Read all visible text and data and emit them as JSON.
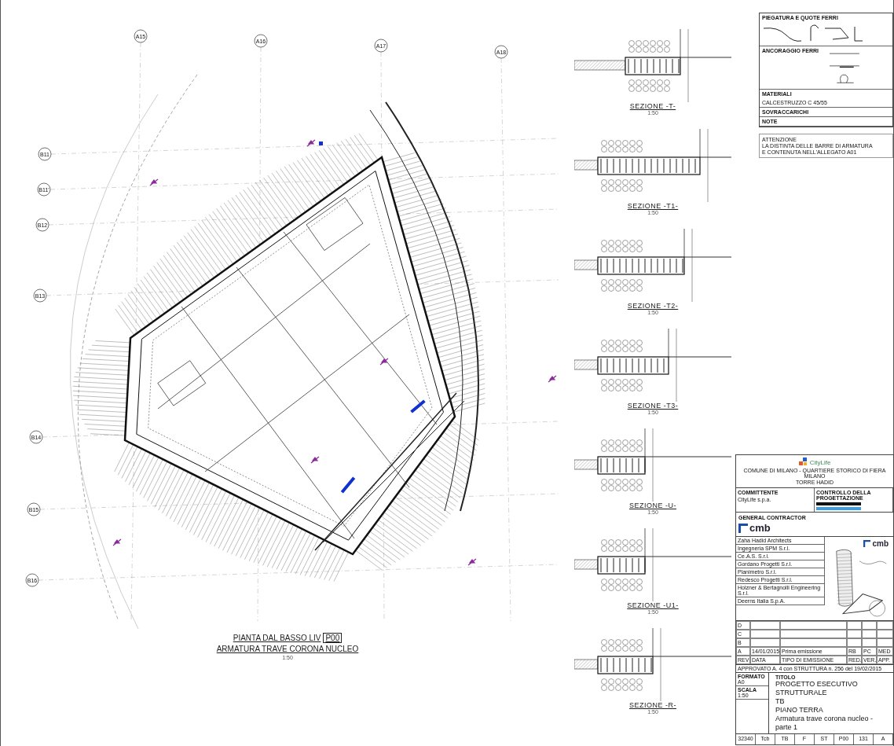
{
  "plan": {
    "axes": [
      {
        "label": "A15"
      },
      {
        "label": "A16"
      },
      {
        "label": "A17"
      },
      {
        "label": "A18"
      },
      {
        "label": "B11"
      },
      {
        "label": "B11'"
      },
      {
        "label": "B12"
      },
      {
        "label": "B13"
      },
      {
        "label": "B14"
      },
      {
        "label": "B15"
      },
      {
        "label": "B16"
      }
    ],
    "title": "PIANTA DAL BASSO LIV",
    "level": "P00",
    "subtitle": "ARMATURA TRAVE CORONA NUCLEO",
    "scale": "1:50"
  },
  "sections": [
    {
      "title": "SEZIONE -T-",
      "scale": "1:50"
    },
    {
      "title": "SEZIONE -T1-",
      "scale": "1:50"
    },
    {
      "title": "SEZIONE -T2-",
      "scale": "1:50"
    },
    {
      "title": "SEZIONE -T3-",
      "scale": "1:50"
    },
    {
      "title": "SEZIONE -U-",
      "scale": "1:50"
    },
    {
      "title": "SEZIONE -U1-",
      "scale": "1:50"
    },
    {
      "title": "SEZIONE -R-",
      "scale": "1:50"
    }
  ],
  "legend": {
    "bending_title": "PIEGATURA E QUOTE FERRI",
    "anchorage_title": "ANCORAGGIO FERRI",
    "materials_title": "MATERIALI",
    "materials_text": "CALCESTRUZZO C 45/55",
    "loads_title": "SOVRACCARICHI",
    "notes_title": "NOTE"
  },
  "warning": [
    "ATTENZIONE",
    "LA DISTINTA DELLE BARRE DI ARMATURA",
    "E CONTENUTA NELL'ALLEGATO A01"
  ],
  "title_block": {
    "logo_text": "CityLife",
    "project": "COMUNE DI MILANO - QUARTIERE STORICO DI FIERA MILANO",
    "building": "TORRE HADID",
    "client_label": "COMMITTENTE",
    "client": "CityLife s.p.a.",
    "control_label": "CONTROLLO DELLA PROGETTAZIONE",
    "contractor_label": "GENERAL CONTRACTOR",
    "contractor": "cmb",
    "companies": [
      "Zaha Hadid Architects",
      "Ingegneria SPM S.r.l.",
      "Ce.A.S. S.r.l.",
      "Gordano Progetti S.r.l.",
      "Planimetro S.r.l.",
      "Redesco Progetti S.r.l.",
      "Holzner & Bertagnolli Engineering S.r.l.",
      "Deerns Italia S.p.A."
    ],
    "sketch_logo": "cmb",
    "revisions": [
      {
        "rev": "D"
      },
      {
        "rev": "C"
      },
      {
        "rev": "B"
      },
      {
        "rev": "A",
        "date": "14/01/2015",
        "type": "Prima emissione",
        "red": "RB",
        "ver": "PC",
        "app": "MED"
      }
    ],
    "revision_header": [
      "REV",
      "DATA",
      "TIPO DI EMISSIONE",
      "RED.",
      "VER.",
      "APP."
    ],
    "approval": "APPROVATO A. 4 con STRUTTURA n. 256 del 19/02/2015",
    "format_label": "FORMATO",
    "format": "A0",
    "scale_label": "SCALA",
    "scale": "1:50",
    "title_label": "TITOLO",
    "title_lines": [
      "PROGETTO ESECUTIVO STRUTTURALE",
      "TB",
      "PIANO TERRA",
      "Armatura trave corona nucleo - parte 1"
    ],
    "codes": [
      "32340",
      "Tcb",
      "TB",
      "F",
      "ST",
      "P00",
      "131",
      "A"
    ]
  }
}
